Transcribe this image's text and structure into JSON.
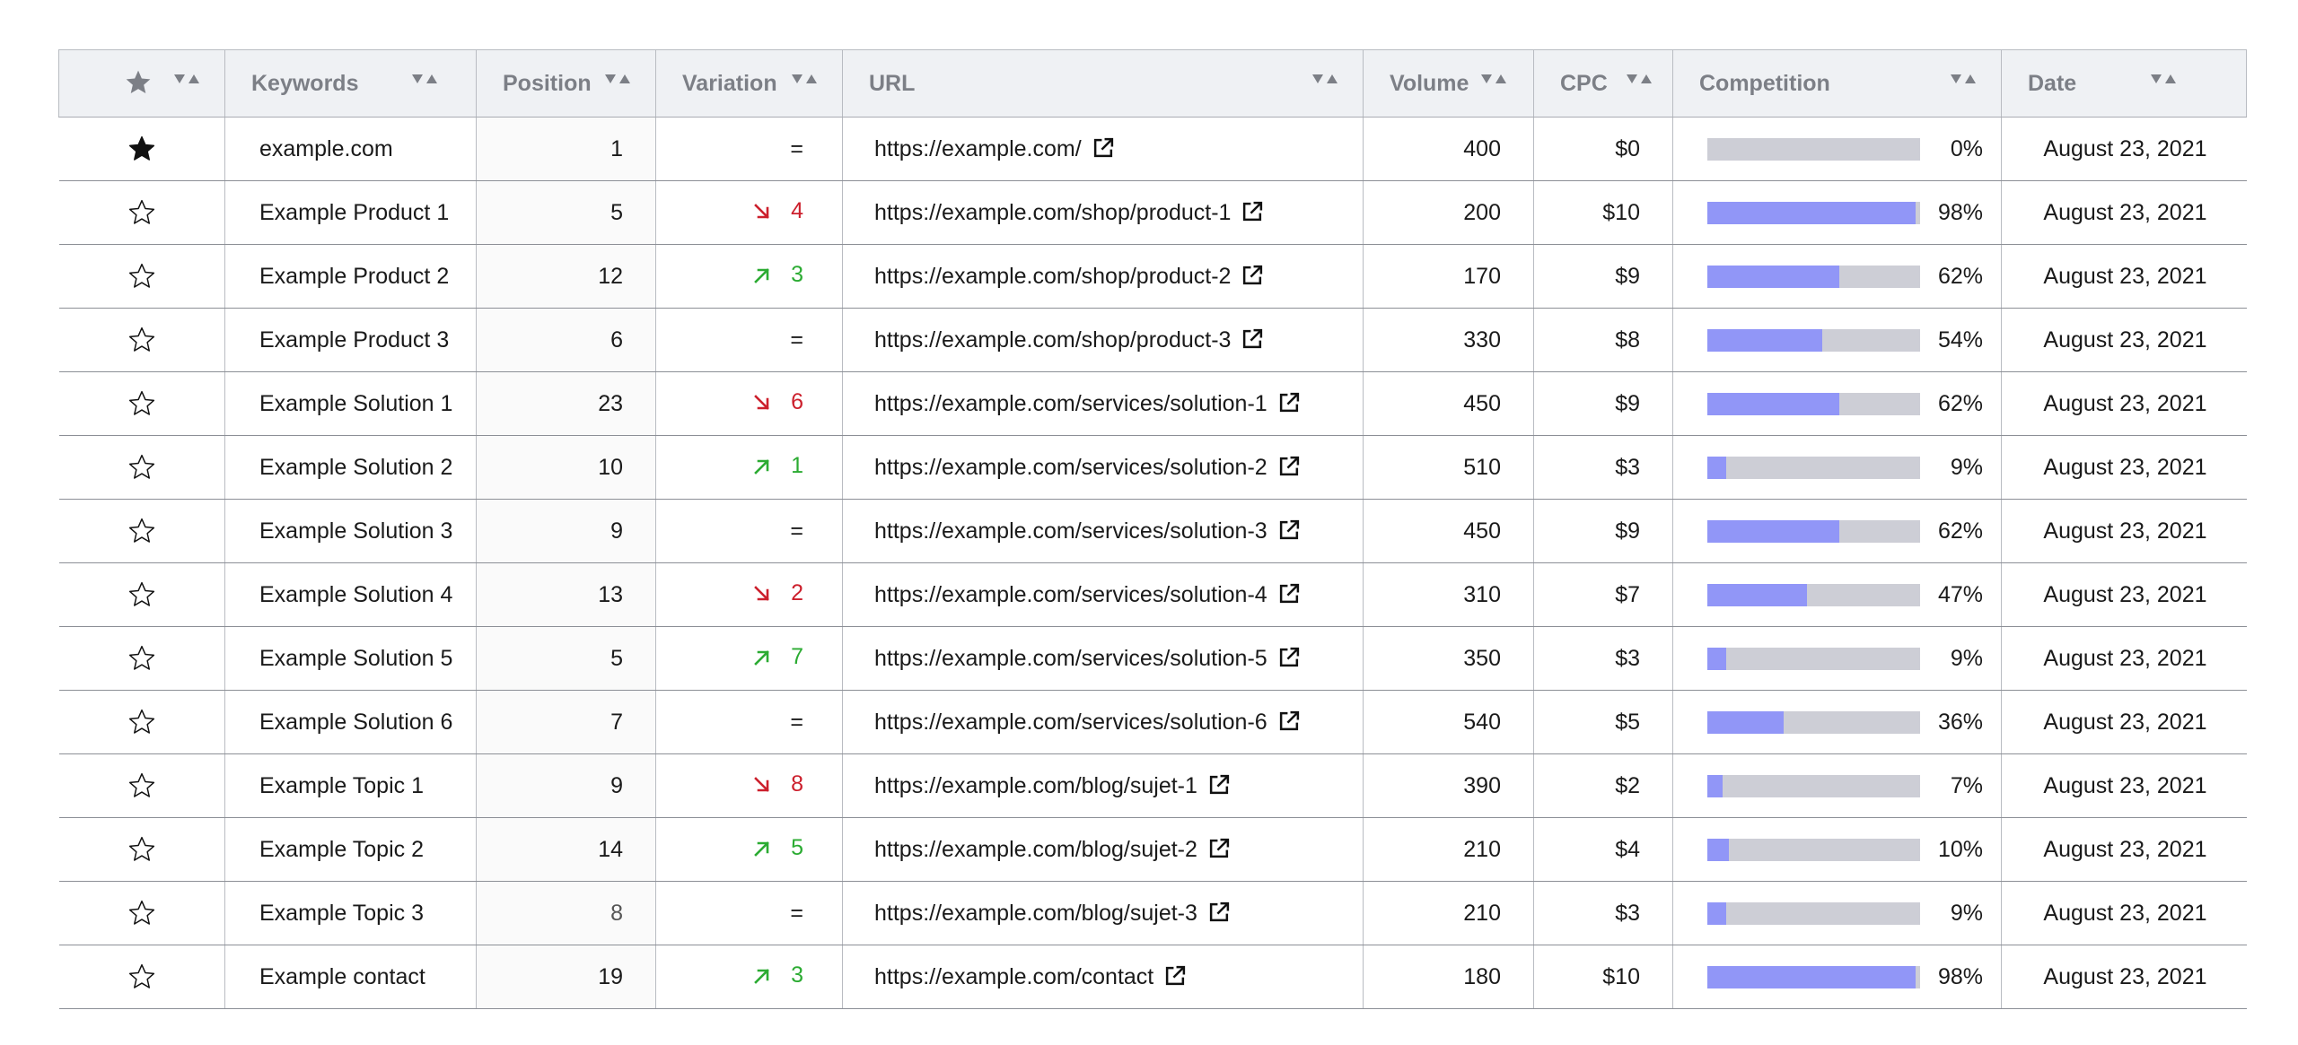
{
  "columns": {
    "keywords": "Keywords",
    "position": "Position",
    "variation": "Variation",
    "url": "URL",
    "volume": "Volume",
    "cpc": "CPC",
    "competition": "Competition",
    "date": "Date"
  },
  "colors": {
    "competition_fill": "#9196f7",
    "competition_track": "#cdced6",
    "variation_down": "#cc1f2c",
    "variation_up": "#2bab32"
  },
  "rows": [
    {
      "starred": true,
      "keyword": "example.com",
      "position": "1",
      "variation": {
        "trend": "same",
        "value": "="
      },
      "url": "https://example.com/",
      "volume": "400",
      "cpc": "$0",
      "competition": 0.0,
      "competition_label": "0%",
      "date": "August 23, 2021"
    },
    {
      "starred": false,
      "keyword": "Example Product 1",
      "position": "5",
      "variation": {
        "trend": "down",
        "value": "4"
      },
      "url": "https://example.com/shop/product-1",
      "volume": "200",
      "cpc": "$10",
      "competition": 0.98,
      "competition_label": "98%",
      "date": "August 23, 2021"
    },
    {
      "starred": false,
      "keyword": "Example Product 2",
      "position": "12",
      "variation": {
        "trend": "up",
        "value": "3"
      },
      "url": "https://example.com/shop/product-2",
      "volume": "170",
      "cpc": "$9",
      "competition": 0.62,
      "competition_label": "62%",
      "date": "August 23, 2021"
    },
    {
      "starred": false,
      "keyword": "Example Product 3",
      "position": "6",
      "variation": {
        "trend": "same",
        "value": "="
      },
      "url": "https://example.com/shop/product-3",
      "volume": "330",
      "cpc": "$8",
      "competition": 0.54,
      "competition_label": "54%",
      "date": "August 23, 2021"
    },
    {
      "starred": false,
      "keyword": "Example Solution 1",
      "position": "23",
      "variation": {
        "trend": "down",
        "value": "6"
      },
      "url": "https://example.com/services/solution-1",
      "volume": "450",
      "cpc": "$9",
      "competition": 0.62,
      "competition_label": "62%",
      "date": "August 23, 2021"
    },
    {
      "starred": false,
      "keyword": "Example Solution 2",
      "position": "10",
      "variation": {
        "trend": "up",
        "value": "1"
      },
      "url": "https://example.com/services/solution-2",
      "volume": "510",
      "cpc": "$3",
      "competition": 0.09,
      "competition_label": "9%",
      "date": "August 23, 2021"
    },
    {
      "starred": false,
      "keyword": "Example Solution 3",
      "position": "9",
      "variation": {
        "trend": "same",
        "value": "="
      },
      "url": "https://example.com/services/solution-3",
      "volume": "450",
      "cpc": "$9",
      "competition": 0.62,
      "competition_label": "62%",
      "date": "August 23, 2021"
    },
    {
      "starred": false,
      "keyword": "Example Solution 4",
      "position": "13",
      "variation": {
        "trend": "down",
        "value": "2"
      },
      "url": "https://example.com/services/solution-4",
      "volume": "310",
      "cpc": "$7",
      "competition": 0.47,
      "competition_label": "47%",
      "date": "August 23, 2021"
    },
    {
      "starred": false,
      "keyword": "Example Solution 5",
      "position": "5",
      "variation": {
        "trend": "up",
        "value": "7"
      },
      "url": "https://example.com/services/solution-5",
      "volume": "350",
      "cpc": "$3",
      "competition": 0.09,
      "competition_label": "9%",
      "date": "August 23, 2021"
    },
    {
      "starred": false,
      "keyword": "Example Solution 6",
      "position": "7",
      "variation": {
        "trend": "same",
        "value": "="
      },
      "url": "https://example.com/services/solution-6",
      "volume": "540",
      "cpc": "$5",
      "competition": 0.36,
      "competition_label": "36%",
      "date": "August 23, 2021"
    },
    {
      "starred": false,
      "keyword": "Example Topic 1",
      "position": "9",
      "variation": {
        "trend": "down",
        "value": "8"
      },
      "url": "https://example.com/blog/sujet-1",
      "volume": "390",
      "cpc": "$2",
      "competition": 0.07,
      "competition_label": "7%",
      "date": "August 23, 2021"
    },
    {
      "starred": false,
      "keyword": "Example Topic 2",
      "position": "14",
      "variation": {
        "trend": "up",
        "value": "5"
      },
      "url": "https://example.com/blog/sujet-2",
      "volume": "210",
      "cpc": "$4",
      "competition": 0.1,
      "competition_label": "10%",
      "date": "August 23, 2021"
    },
    {
      "starred": false,
      "keyword": "Example Topic 3",
      "position": "8",
      "position_muted": true,
      "variation": {
        "trend": "same",
        "value": "="
      },
      "url": "https://example.com/blog/sujet-3",
      "volume": "210",
      "cpc": "$3",
      "competition": 0.09,
      "competition_label": "9%",
      "date": "August 23, 2021"
    },
    {
      "starred": false,
      "keyword": "Example contact",
      "position": "19",
      "variation": {
        "trend": "up",
        "value": "3"
      },
      "url": "https://example.com/contact",
      "volume": "180",
      "cpc": "$10",
      "competition": 0.98,
      "competition_label": "98%",
      "date": "August 23, 2021"
    }
  ]
}
